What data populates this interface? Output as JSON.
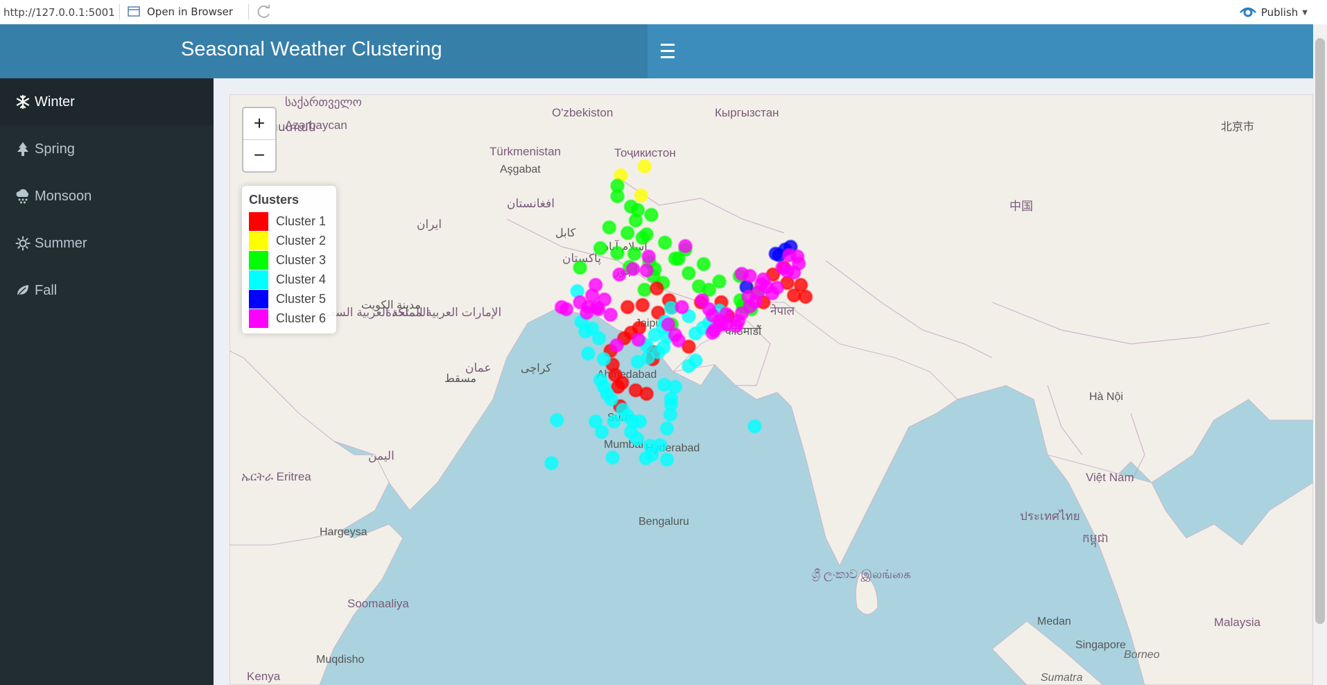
{
  "browser": {
    "url": "http://127.0.0.1:5001",
    "open_in_browser": "Open in Browser",
    "publish": "Publish"
  },
  "app": {
    "title": "Seasonal Weather Clustering"
  },
  "sidebar": {
    "items": [
      {
        "label": "Winter",
        "icon": "snowflake-icon",
        "active": true
      },
      {
        "label": "Spring",
        "icon": "tree-icon",
        "active": false
      },
      {
        "label": "Monsoon",
        "icon": "rain-cloud-icon",
        "active": false
      },
      {
        "label": "Summer",
        "icon": "sun-icon",
        "active": false
      },
      {
        "label": "Fall",
        "icon": "leaf-icon",
        "active": false
      }
    ]
  },
  "map": {
    "zoom_in": "+",
    "zoom_out": "−",
    "legend": {
      "title": "Clusters",
      "items": [
        {
          "label": "Cluster 1",
          "color": "#ff0000"
        },
        {
          "label": "Cluster 2",
          "color": "#ffff00"
        },
        {
          "label": "Cluster 3",
          "color": "#00ff00"
        },
        {
          "label": "Cluster 4",
          "color": "#00ffff"
        },
        {
          "label": "Cluster 5",
          "color": "#0000ff"
        },
        {
          "label": "Cluster 6",
          "color": "#ff00ff"
        }
      ]
    },
    "labels": {
      "uzbekistan": "O'zbekiston",
      "kyrgyzstan": "Кыргызстан",
      "turkmenistan": "Türkmenistan",
      "tajikistan": "Тоҷикистон",
      "ashgabat": "Aşgabat",
      "azerbaijan": "Azərbaycan",
      "armenia": "Հայաստան",
      "georgia": "საქართველო",
      "pakistan": "پاکستان",
      "afghanistan": "افغانستان",
      "iran": "ایران",
      "saudi": "المملكة العربية السعودية",
      "uae": "الإمارات العربية المتحدة",
      "oman": "عمان",
      "yemen": "اليمن",
      "eritrea": "ኤርትራ Eritrea",
      "hargeysa": "Hargeysa",
      "somalia": "Soomaaliya",
      "mogadishu": "Muqdisho",
      "kenya": "Kenya",
      "china": "中国",
      "beijing": "北京市",
      "hanoi": "Hà Nội",
      "vietnam": "Việt Nam",
      "thailand": "ประเทศไทย",
      "cambodia": "កម្ពុជា",
      "medan": "Medan",
      "singapore": "Singapore",
      "malaysia": "Malaysia",
      "srilanka": "ශ්‍රී ලංකාව இலங்கை",
      "jaipur": "Jaipur",
      "ahmedabad": "Ahmedabad",
      "surat": "Surat",
      "mumbai": "Mumbai",
      "hyderabad": "Hyderabad",
      "bengaluru": "Bengaluru",
      "borneo": "Borneo",
      "sumatra": "Sumatra",
      "kathmandu": "काठमाडौं",
      "nepal": "नेपाल",
      "lahore": "لاہور",
      "islamabad": "اسلام آباد",
      "kabul": "کابل",
      "karachi": "کراچی",
      "muscat": "مسقط",
      "kuwait": "مدينة الكويت"
    },
    "stations": [
      [
        4,
        "#ffff00"
      ],
      [
        6,
        "#ffff00"
      ],
      [
        10,
        "#ffff00"
      ],
      [
        8,
        "#ffff00"
      ],
      [
        1,
        "#ff0000"
      ],
      [
        1,
        "#ff0000"
      ],
      [
        1,
        "#ff0000"
      ],
      [
        1,
        "#ff0000"
      ],
      [
        1,
        "#ff0000"
      ],
      [
        1,
        "#ff0000"
      ],
      [
        1,
        "#ff0000"
      ],
      [
        1,
        "#ff0000"
      ],
      [
        1,
        "#ff0000"
      ],
      [
        1,
        "#ff0000"
      ],
      [
        1,
        "#ff0000"
      ],
      [
        1,
        "#ff0000"
      ],
      [
        1,
        "#ff0000"
      ],
      [
        1,
        "#ff0000"
      ],
      [
        1,
        "#ff0000"
      ],
      [
        1,
        "#ff0000"
      ],
      [
        1,
        "#ff0000"
      ],
      [
        1,
        "#ff0000"
      ],
      [
        1,
        "#ff0000"
      ],
      [
        1,
        "#ff0000"
      ],
      [
        1,
        "#ff0000"
      ],
      [
        1,
        "#ff0000"
      ],
      [
        1,
        "#ff0000"
      ],
      [
        1,
        "#ff0000"
      ]
    ]
  }
}
